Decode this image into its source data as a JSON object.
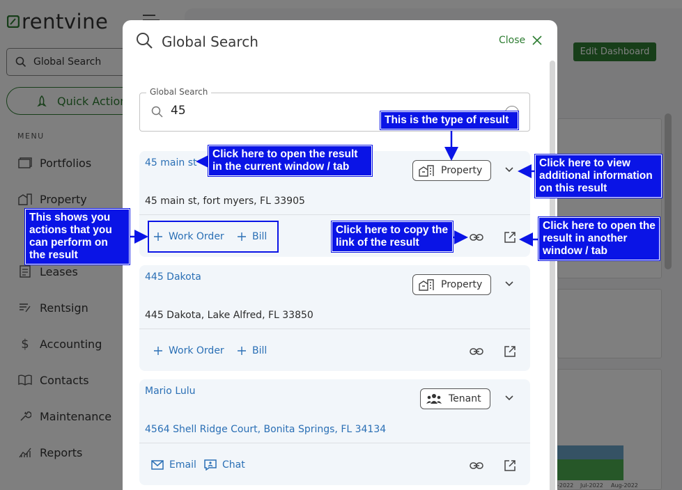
{
  "app": {
    "logo": "rentvine",
    "sidebar_search": "Global Search",
    "quick_actions": "Quick Actions",
    "menu_label": "MENU",
    "nav": [
      {
        "label": "Portfolios",
        "icon": "folders-icon"
      },
      {
        "label": "Property",
        "icon": "building-icon"
      },
      {
        "label": "Leases",
        "icon": "document-icon"
      },
      {
        "label": "Rentsign",
        "icon": "sign-icon"
      },
      {
        "label": "Accounting",
        "icon": "dollar-icon"
      },
      {
        "label": "Contacts",
        "icon": "book-icon"
      },
      {
        "label": "Maintenance",
        "icon": "wrench-icon"
      },
      {
        "label": "Reports",
        "icon": "chart-icon"
      }
    ],
    "edit_dashboard": "Edit Dashboard",
    "chart_ticks": [
      "-2022",
      "Jul-2022",
      "Aug-2022"
    ]
  },
  "modal": {
    "title": "Global Search",
    "close": "Close",
    "search": {
      "label": "Global Search",
      "value": "45"
    },
    "results": [
      {
        "title": "45 main st",
        "type": "Property",
        "type_icon": "building-icon",
        "subtitle": "45 main st, fort myers, FL 33905",
        "actions": [
          {
            "label": "Work Order",
            "icon": "plus-icon"
          },
          {
            "label": "Bill",
            "icon": "plus-icon"
          }
        ]
      },
      {
        "title": "445 Dakota",
        "type": "Property",
        "type_icon": "building-icon",
        "subtitle": "445 Dakota, Lake Alfred, FL 33850",
        "actions": [
          {
            "label": "Work Order",
            "icon": "plus-icon"
          },
          {
            "label": "Bill",
            "icon": "plus-icon"
          }
        ]
      },
      {
        "title": "Mario Lulu",
        "type": "Tenant",
        "type_icon": "people-icon",
        "subtitle": "4564 Shell Ridge Court, Bonita Springs, FL 34134",
        "actions": [
          {
            "label": "Email",
            "icon": "mail-icon"
          },
          {
            "label": "Chat",
            "icon": "chat-icon"
          }
        ]
      }
    ]
  },
  "annotations": {
    "type": "This is the type of result",
    "open_current": "Click here to open the result in the current window / tab",
    "view_info": "Click here to view additional information on this result",
    "actions": "This shows you actions that you can perform on the result",
    "copy_link": "Click here to copy the link of the result",
    "open_new": "Click here to open the result in another window / tab"
  },
  "colors": {
    "accent": "#2e7d32",
    "link": "#2a6fb5",
    "annotation": "#0a14e6",
    "result_bg": "#f2f6fa"
  }
}
